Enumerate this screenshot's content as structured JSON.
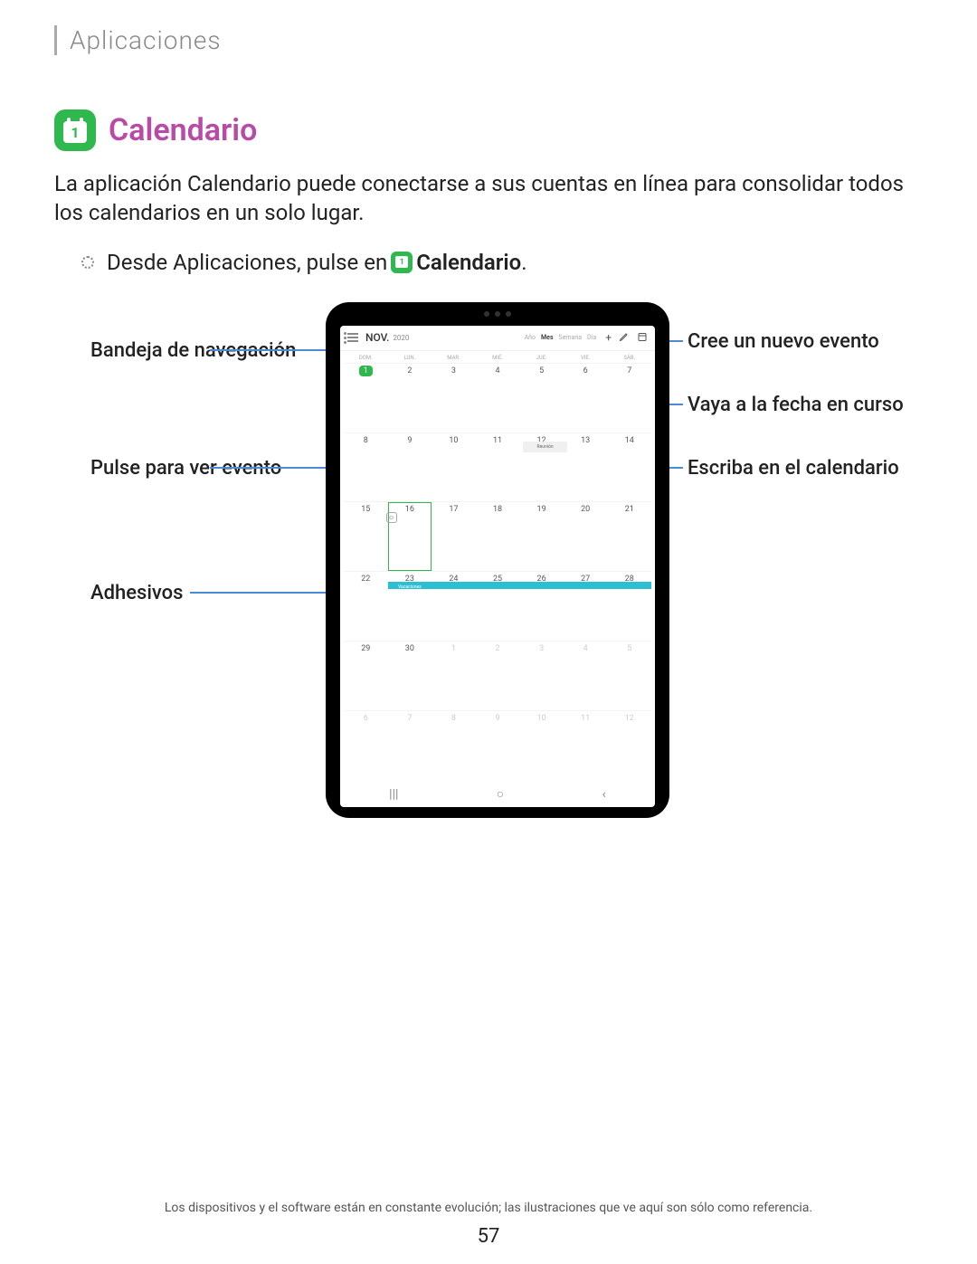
{
  "section_header": "Aplicaciones",
  "app_icon_number": "1",
  "title": "Calendario",
  "description": "La aplicación Calendario puede conectarse a sus cuentas en línea para consolidar todos los calendarios en un solo lugar.",
  "instruction_prefix": "Desde Aplicaciones, pulse en ",
  "instruction_app_name": "Calendario",
  "small_icon_number": "1",
  "callouts": {
    "nav_drawer": "Bandeja de navegación",
    "tap_event": "Pulse para ver evento",
    "stickers": "Adhesivos",
    "new_event": "Cree un nuevo evento",
    "go_today": "Vaya a la fecha en curso",
    "write_cal": "Escriba en el calendario"
  },
  "calendar": {
    "month": "NOV.",
    "year": "2020",
    "view_tabs": [
      "Año",
      "Mes",
      "Semana",
      "Día"
    ],
    "active_tab": "Mes",
    "dow": [
      "DOM.",
      "LUN.",
      "MAR.",
      "MIÉ.",
      "JUE.",
      "VIE.",
      "SÁB."
    ],
    "today": "1",
    "event_label": "Reunión",
    "vacation_label": "Vacaciones",
    "weeks": [
      [
        "1",
        "2",
        "3",
        "4",
        "5",
        "6",
        "7"
      ],
      [
        "8",
        "9",
        "10",
        "11",
        "12",
        "13",
        "14"
      ],
      [
        "15",
        "16",
        "17",
        "18",
        "19",
        "20",
        "21"
      ],
      [
        "22",
        "23",
        "24",
        "25",
        "26",
        "27",
        "28"
      ],
      [
        "29",
        "30",
        "1",
        "2",
        "3",
        "4",
        "5"
      ],
      [
        "6",
        "7",
        "8",
        "9",
        "10",
        "11",
        "12"
      ]
    ]
  },
  "disclaimer": "Los dispositivos y el software están en constante evolución; las ilustraciones que ve aquí son sólo como referencia.",
  "page_number": "57"
}
